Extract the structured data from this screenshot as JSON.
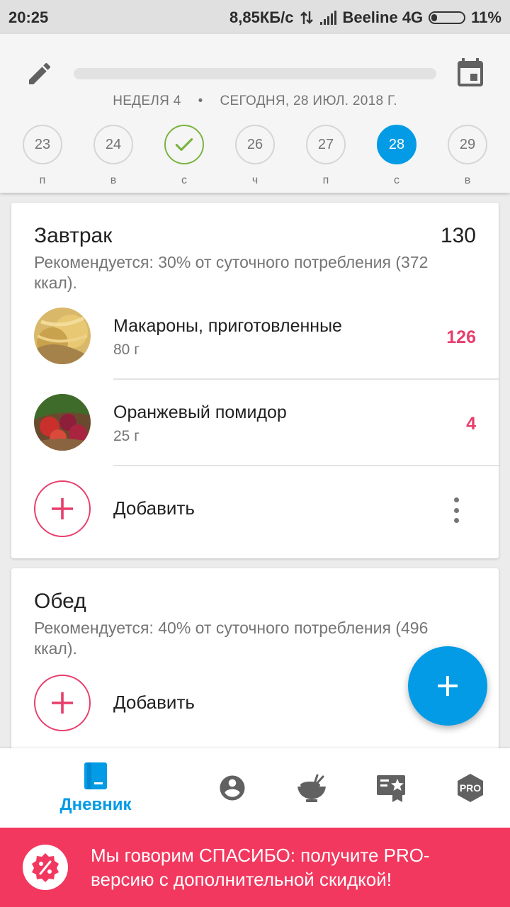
{
  "status_bar": {
    "time": "20:25",
    "network_speed": "8,85КБ/с",
    "carrier": "Beeline 4G",
    "battery": "11%"
  },
  "header": {
    "week": "НЕДЕЛЯ 4",
    "separator": "•",
    "today": "СЕГОДНЯ, 28 ИЮЛ. 2018 Г.",
    "days": [
      {
        "num": "23",
        "name": "п",
        "state": "normal"
      },
      {
        "num": "24",
        "name": "в",
        "state": "normal"
      },
      {
        "num": "",
        "name": "с",
        "state": "done"
      },
      {
        "num": "26",
        "name": "ч",
        "state": "normal"
      },
      {
        "num": "27",
        "name": "п",
        "state": "normal"
      },
      {
        "num": "28",
        "name": "с",
        "state": "today"
      },
      {
        "num": "29",
        "name": "в",
        "state": "normal"
      }
    ]
  },
  "breakfast": {
    "title": "Завтрак",
    "total": "130",
    "recommendation": "Рекомендуется: 30% от суточного потребления (372 ккал).",
    "items": [
      {
        "name": "Макароны, приготовленные",
        "qty": "80 г",
        "calories": "126"
      },
      {
        "name": "Оранжевый помидор",
        "qty": "25 г",
        "calories": "4"
      }
    ],
    "add_label": "Добавить"
  },
  "lunch": {
    "title": "Обед",
    "recommendation": "Рекомендуется: 40% от суточного потребления (496 ккал).",
    "add_label": "Добавить"
  },
  "bottom_nav": {
    "diary_label": "Дневник",
    "pro_label": "PRO"
  },
  "promo": {
    "text": "Мы говорим СПАСИБО: получите PRO-версию с дополнительной скидкой!"
  },
  "colors": {
    "accent": "#039be5",
    "calories": "#e83e6c",
    "promo_bg": "#f2385f",
    "done": "#7cb342"
  }
}
